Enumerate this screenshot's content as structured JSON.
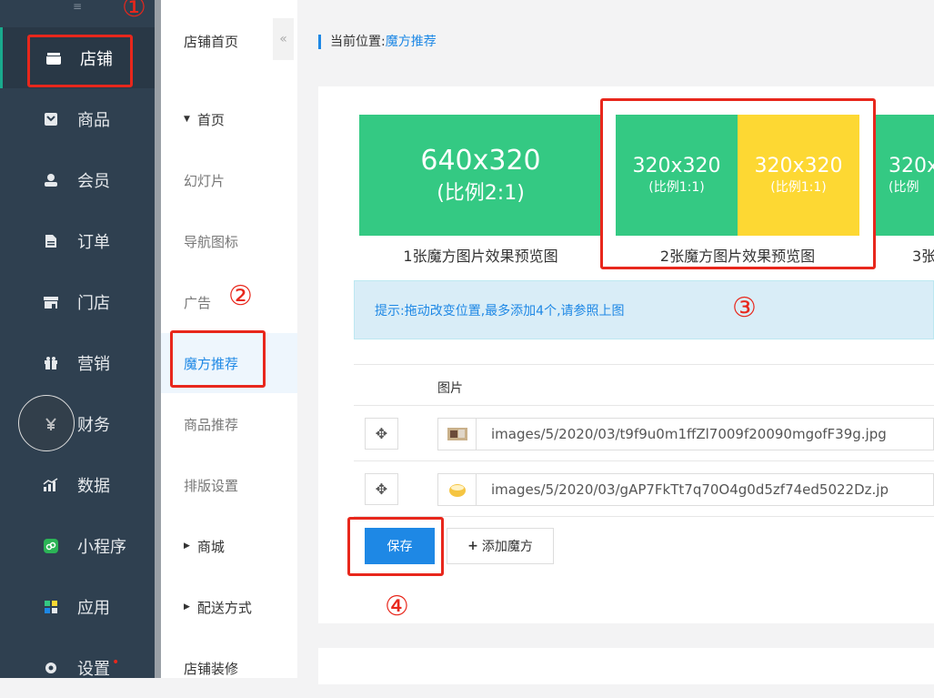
{
  "sidebar": {
    "collapse_glyph": "≡",
    "items": [
      {
        "label": "店铺",
        "icon": "store-icon"
      },
      {
        "label": "商品",
        "icon": "product-icon"
      },
      {
        "label": "会员",
        "icon": "member-icon"
      },
      {
        "label": "订单",
        "icon": "order-icon"
      },
      {
        "label": "门店",
        "icon": "shop-icon"
      },
      {
        "label": "营销",
        "icon": "gift-icon"
      },
      {
        "label": "财务",
        "icon": "finance-icon"
      },
      {
        "label": "数据",
        "icon": "chart-icon"
      },
      {
        "label": "小程序",
        "icon": "miniprogram-icon"
      },
      {
        "label": "应用",
        "icon": "apps-icon"
      },
      {
        "label": "设置",
        "icon": "settings-icon"
      }
    ]
  },
  "submenu": {
    "title": "店铺首页",
    "collapse": "«",
    "items": [
      {
        "label": "首页"
      },
      {
        "label": "幻灯片"
      },
      {
        "label": "导航图标"
      },
      {
        "label": "广告"
      },
      {
        "label": "魔方推荐"
      },
      {
        "label": "商品推荐"
      },
      {
        "label": "排版设置"
      },
      {
        "label": "商城"
      },
      {
        "label": "配送方式"
      },
      {
        "label": "店铺装修"
      }
    ]
  },
  "breadcrumb": {
    "prefix": "当前位置:",
    "current": "魔方推荐"
  },
  "previews": [
    {
      "size": "640x320",
      "ratio": "(比例2:1)",
      "caption": "1张魔方图片效果预览图"
    },
    {
      "left_size": "320x320",
      "left_ratio": "(比例1:1)",
      "right_size": "320x320",
      "right_ratio": "(比例1:1)",
      "caption": "2张魔方图片效果预览图"
    },
    {
      "size": "320x",
      "ratio": "(比例",
      "caption": "3张"
    }
  ],
  "tip": "提示:拖动改变位置,最多添加4个,请参照上图",
  "table": {
    "header": "图片",
    "rows": [
      {
        "path": "images/5/2020/03/t9f9u0m1ffZl7009f20090mgofF39g.jpg"
      },
      {
        "path": "images/5/2020/03/gAP7FkTt7q70O4g0d5zf74ed5022Dz.jp"
      }
    ]
  },
  "buttons": {
    "save": "保存",
    "add": "添加魔方",
    "add_prefix": "+"
  },
  "annotations": [
    "①",
    "②",
    "③",
    "④"
  ],
  "colors": {
    "green": "#34c983",
    "yellow": "#fdd833",
    "accent": "#1e88e5",
    "red": "#e8271c"
  }
}
